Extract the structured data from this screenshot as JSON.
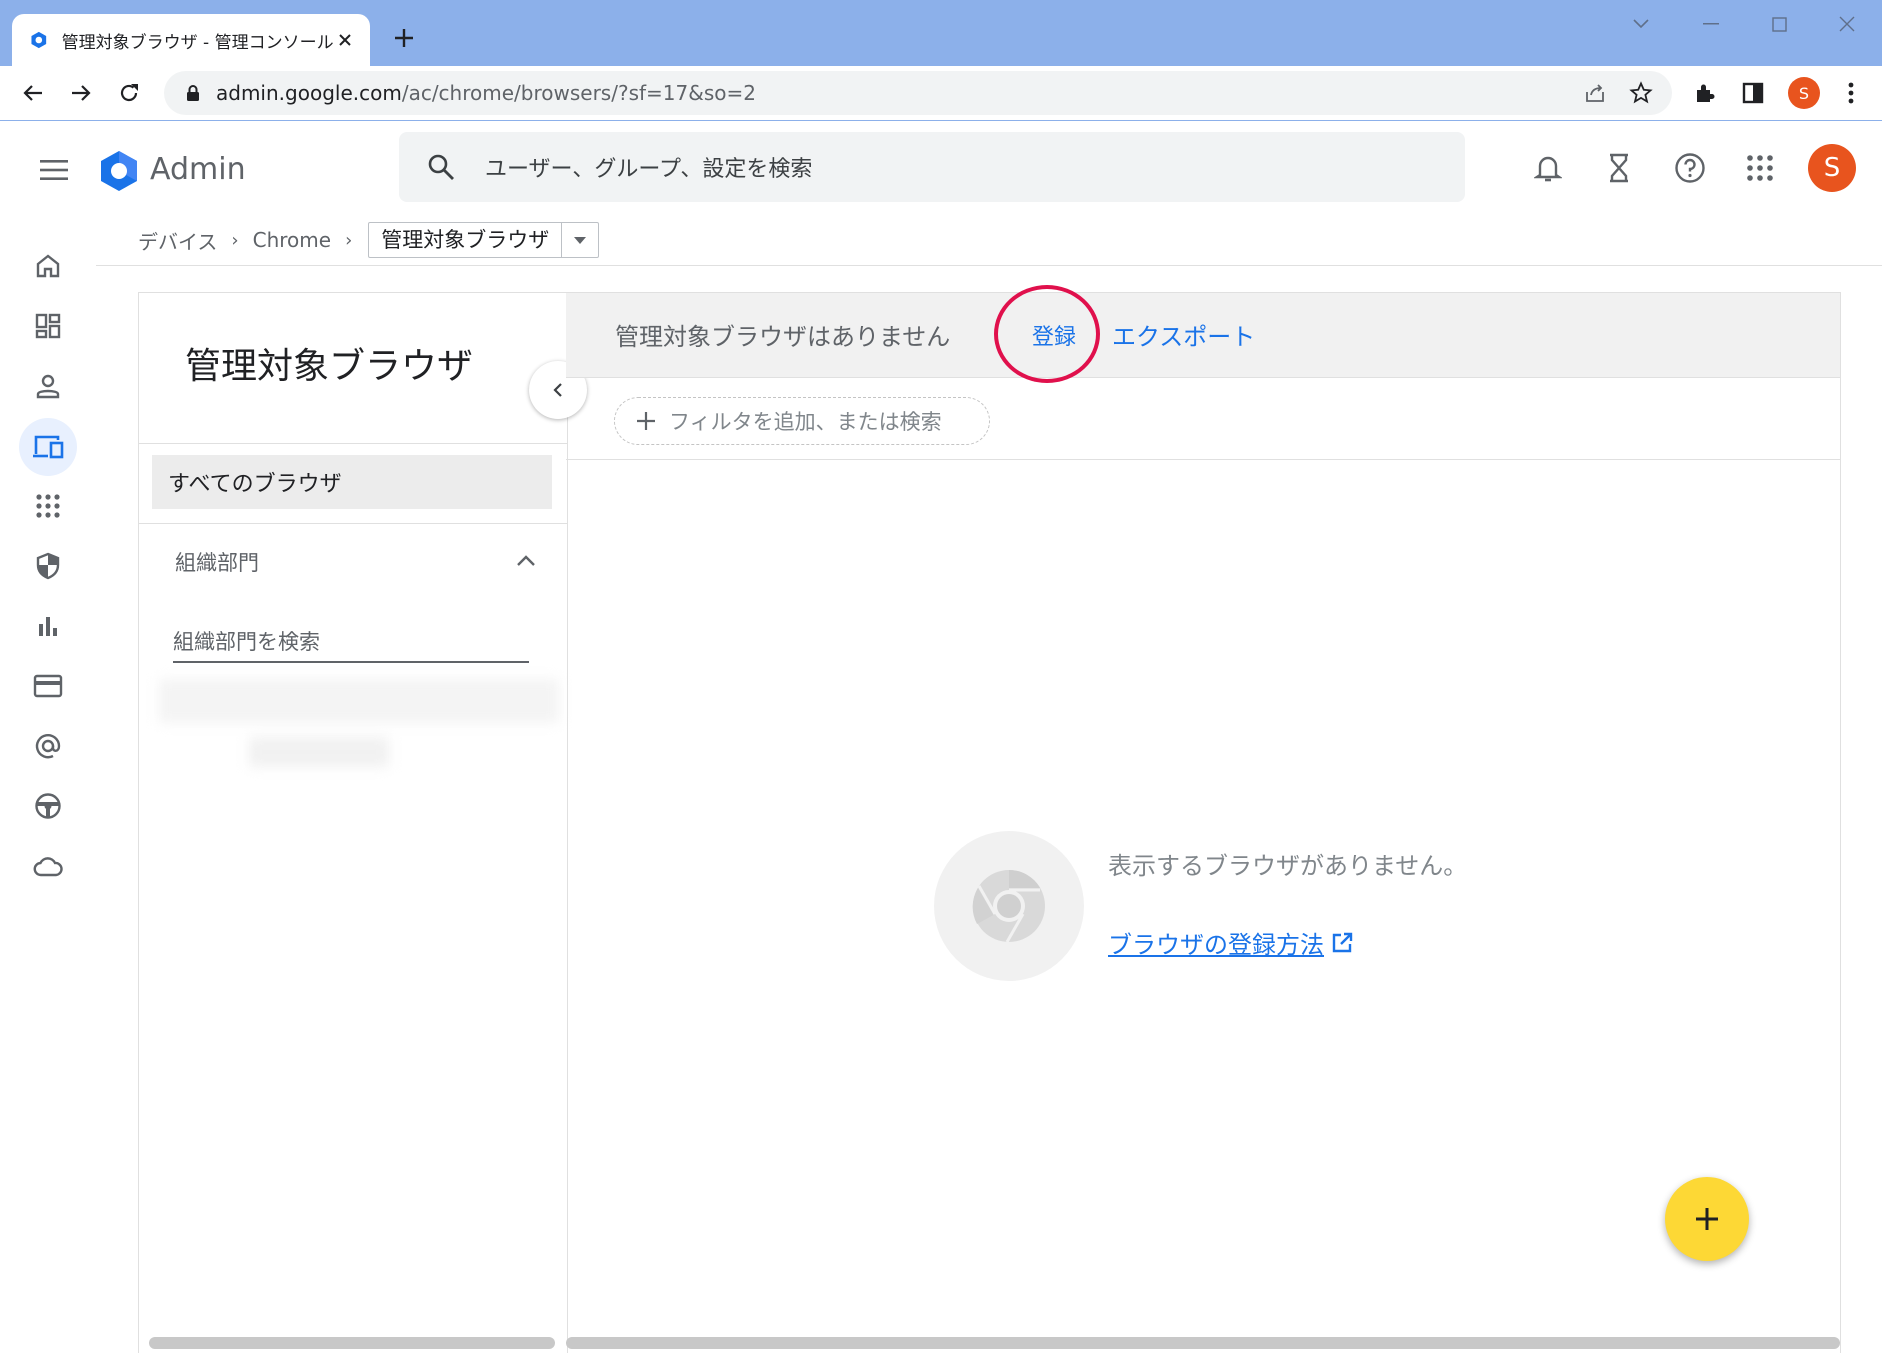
{
  "browser": {
    "tab_title": "管理対象ブラウザ - 管理コンソール",
    "url_host": "admin.google.com",
    "url_path": "/ac/chrome/browsers/?sf=17&so=2",
    "profile_initial": "S"
  },
  "header": {
    "app_name": "Admin",
    "search_placeholder": "ユーザー、グループ、設定を検索",
    "avatar_initial": "S"
  },
  "breadcrumb": {
    "items": [
      "デバイス",
      "Chrome"
    ],
    "current": "管理対象ブラウザ"
  },
  "rail": {
    "icons": [
      "home-icon",
      "dashboard-icon",
      "person-icon",
      "devices-icon",
      "apps-icon",
      "security-icon",
      "reports-icon",
      "billing-icon",
      "account-icon",
      "rules-icon",
      "cloud-icon"
    ],
    "active": "devices-icon"
  },
  "left_panel": {
    "title": "管理対象ブラウザ",
    "all_browsers": "すべてのブラウザ",
    "org_units_heading": "組織部門",
    "org_search_placeholder": "組織部門を検索"
  },
  "main": {
    "status": "管理対象ブラウザはありません",
    "enroll": "登録",
    "export": "エクスポート",
    "filter_placeholder": "フィルタを追加、または検索",
    "empty_message": "表示するブラウザがありません。",
    "howto_link": "ブラウザの登録方法"
  },
  "colors": {
    "link": "#1a73e8",
    "highlight_ring": "#e0104c",
    "fab": "#fdd835",
    "avatar": "#e8541e"
  }
}
